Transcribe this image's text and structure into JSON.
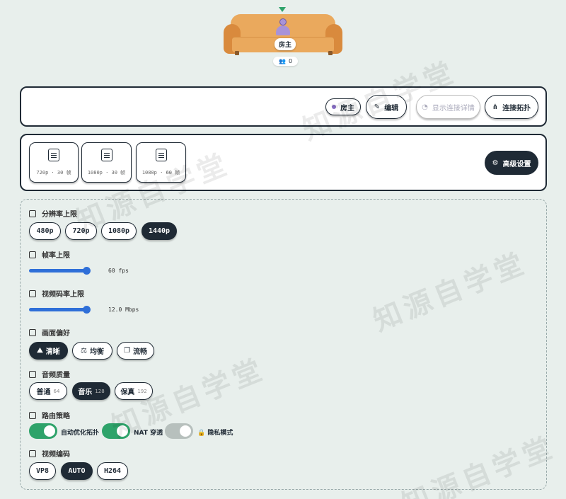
{
  "room": {
    "host_tag": "房主",
    "viewer_count": "0"
  },
  "toolbar": {
    "host_label": "房主",
    "edit_label": "编辑",
    "details_label": "显示连接详情",
    "topology_label": "连接拓扑"
  },
  "presets": [
    {
      "label": "720p · 30 帧"
    },
    {
      "label": "1080p · 30 帧"
    },
    {
      "label": "1080p · 60 帧"
    }
  ],
  "advanced_label": "高级设置",
  "settings": {
    "resolution": {
      "title": "分辨率上限",
      "options": [
        "480p",
        "720p",
        "1080p",
        "1440p"
      ],
      "selected": "1440p"
    },
    "framerate": {
      "title": "帧率上限",
      "value": "60 fps",
      "fraction": 1.0
    },
    "bitrate": {
      "title": "视频码率上限",
      "value": "12.0 Mbps",
      "fraction": 1.0
    },
    "quality": {
      "title": "画面偏好",
      "options": [
        "清晰",
        "均衡",
        "流畅"
      ],
      "selected": "清晰"
    },
    "audio": {
      "title": "音频质量",
      "options": [
        {
          "label": "普通",
          "sub": "64"
        },
        {
          "label": "音乐",
          "sub": "128"
        },
        {
          "label": "保真",
          "sub": "192"
        }
      ],
      "selected": "音乐"
    },
    "routing": {
      "title": "路由策略",
      "toggles": [
        {
          "label": "自动优化拓扑",
          "on": true
        },
        {
          "label": "NAT 穿透",
          "on": true
        },
        {
          "label": "隐私模式",
          "on": false
        }
      ]
    },
    "codec": {
      "title": "视频编码",
      "options": [
        "VP8",
        "AUTO",
        "H264"
      ],
      "selected": "AUTO"
    }
  },
  "watermark": "知源自学堂"
}
